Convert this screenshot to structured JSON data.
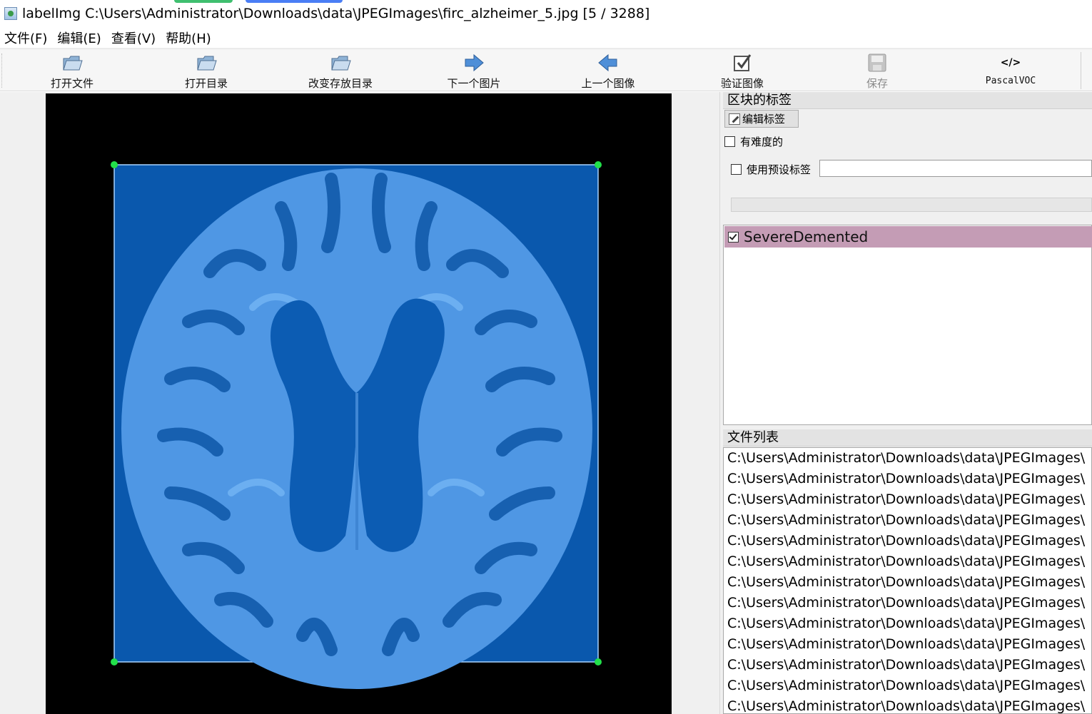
{
  "window": {
    "title": "labelImg C:\\Users\\Administrator\\Downloads\\data\\JPEGImages\\firc_alzheimer_5.jpg [5 / 3288]"
  },
  "menu": [
    "文件(F)",
    "编辑(E)",
    "查看(V)",
    "帮助(H)"
  ],
  "toolbar": {
    "open_file": "打开文件",
    "open_dir": "打开目录",
    "change_save_dir": "改变存放目录",
    "next_image": "下一个图片",
    "prev_image": "上一个图像",
    "verify_image": "验证图像",
    "save": "保存",
    "format": "PascalVOC",
    "format_icon_text": "</>"
  },
  "box_labels_panel": {
    "title": "区块的标签",
    "edit_label_button": "编辑标签",
    "difficult_checkbox": {
      "label": "有难度的",
      "checked": false
    },
    "use_default_label_checkbox": {
      "label": "使用预设标签",
      "checked": false
    },
    "default_label_value": "",
    "labels": [
      {
        "name": "SevereDemented",
        "checked": true,
        "color": "#c49cb5"
      }
    ]
  },
  "file_list_panel": {
    "title": "文件列表",
    "files": [
      "C:\\Users\\Administrator\\Downloads\\data\\JPEGImages\\",
      "C:\\Users\\Administrator\\Downloads\\data\\JPEGImages\\",
      "C:\\Users\\Administrator\\Downloads\\data\\JPEGImages\\",
      "C:\\Users\\Administrator\\Downloads\\data\\JPEGImages\\",
      "C:\\Users\\Administrator\\Downloads\\data\\JPEGImages\\",
      "C:\\Users\\Administrator\\Downloads\\data\\JPEGImages\\",
      "C:\\Users\\Administrator\\Downloads\\data\\JPEGImages\\",
      "C:\\Users\\Administrator\\Downloads\\data\\JPEGImages\\",
      "C:\\Users\\Administrator\\Downloads\\data\\JPEGImages\\",
      "C:\\Users\\Administrator\\Downloads\\data\\JPEGImages\\",
      "C:\\Users\\Administrator\\Downloads\\data\\JPEGImages\\",
      "C:\\Users\\Administrator\\Downloads\\data\\JPEGImages\\",
      "C:\\Users\\Administrator\\Downloads\\data\\JPEGImages\\"
    ]
  },
  "colors": {
    "box_fill": "#0a58ad",
    "box_border": "#a8d3ff",
    "handle": "#22e04a",
    "brain": "#5aa6f2"
  }
}
